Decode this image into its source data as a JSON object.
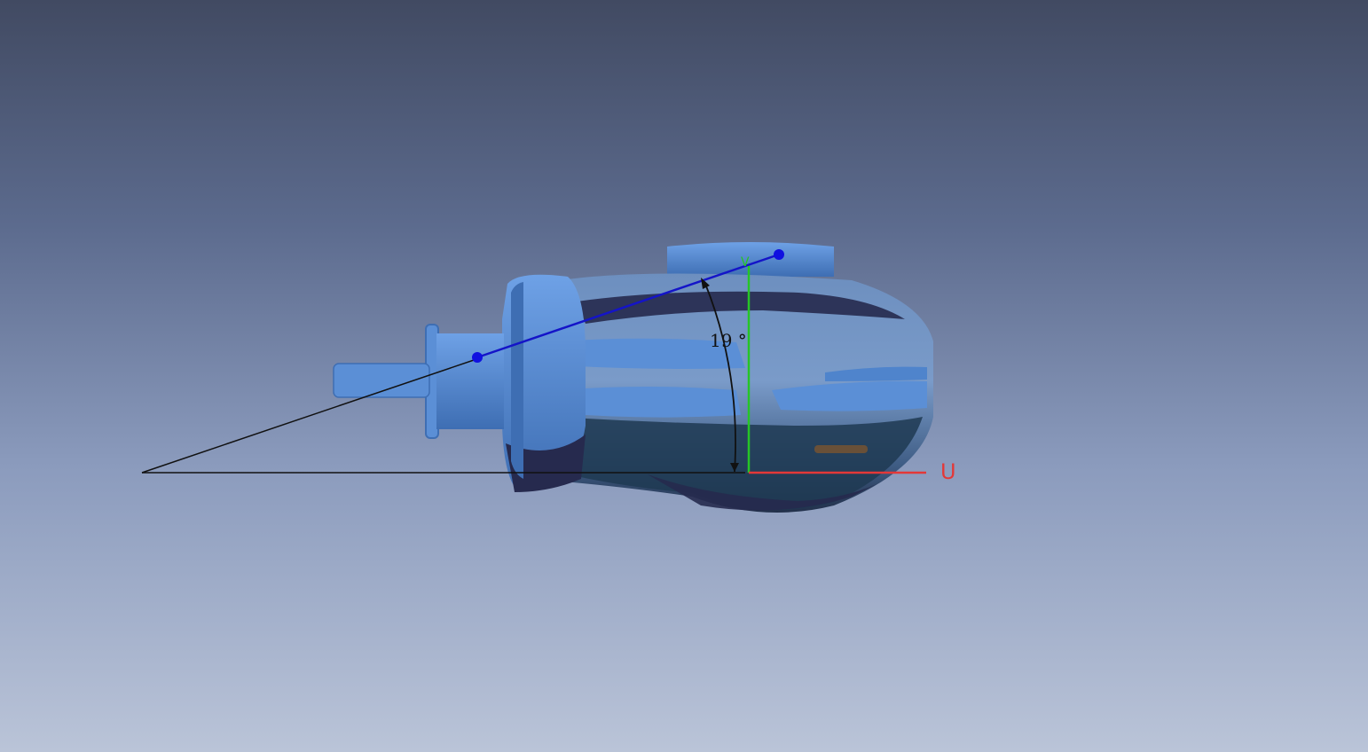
{
  "viewport": {
    "background_top": "#414a62",
    "background_bottom": "#bac4d8"
  },
  "measurement": {
    "angle_label": "19 °",
    "line_color": "#1414c8",
    "point_color": "#1010e0"
  },
  "axes": {
    "u_label": "U",
    "v_label": "V",
    "u_color": "#e33838",
    "v_color": "#26c526"
  },
  "model": {
    "name_icon": "scanned-part-mesh",
    "primary_color": "#5b8fd6",
    "shadow_color": "#262a4e"
  }
}
